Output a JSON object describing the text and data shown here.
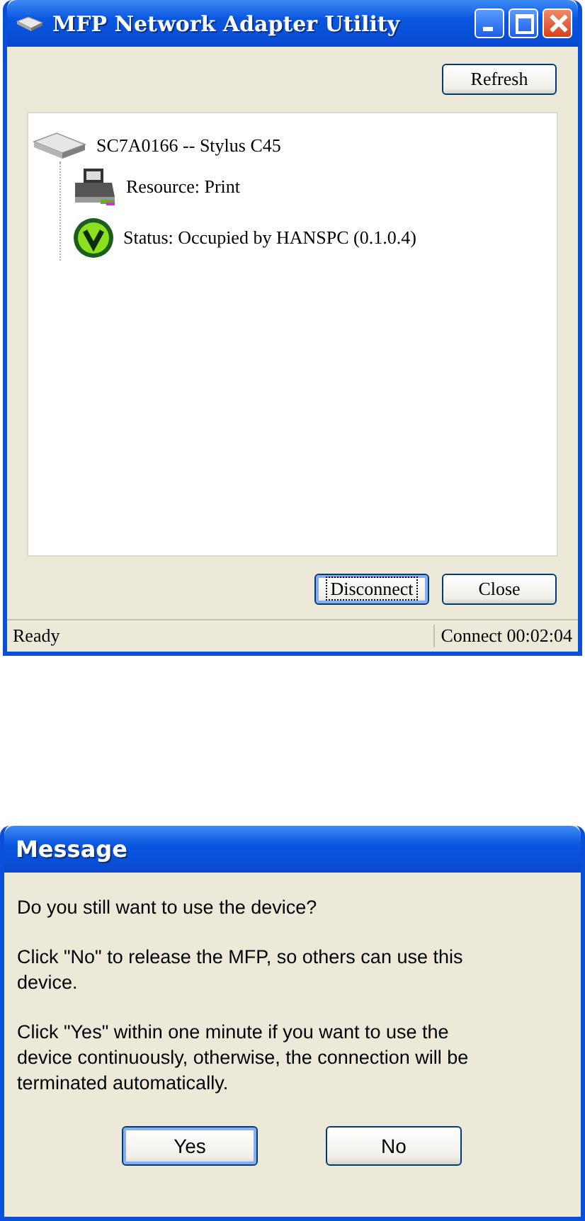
{
  "main_window": {
    "title": "MFP Network Adapter Utility",
    "title_buttons": [
      {
        "kind": "minimize"
      },
      {
        "kind": "maximize"
      },
      {
        "kind": "close"
      }
    ],
    "top_buttons": [
      {
        "label": "Refresh",
        "focused": false
      }
    ],
    "tree": [
      {
        "kind": "adapter",
        "label": "SC7A0166 -- Stylus C45",
        "children": [
          {
            "kind": "printer",
            "label": "Resource: Print"
          },
          {
            "kind": "status-ok",
            "label": "Status: Occupied by HANSPC (0.1.0.4)"
          }
        ]
      }
    ],
    "bottom_buttons": [
      {
        "label": "Disconnect",
        "focused": true
      },
      {
        "label": "Close",
        "focused": false
      }
    ],
    "status_bar": [
      "Ready",
      "Connect 00:02:04"
    ]
  },
  "message_dialog": {
    "title": "Message",
    "paragraphs": [
      "Do you still want to use the device?",
      "Click \"No\" to release the MFP, so others can use this device.",
      "Click \"Yes\" within one minute if you want to use the device continuously,  otherwise, the connection will be terminated automatically."
    ],
    "buttons": [
      {
        "label": "Yes",
        "focused": true
      },
      {
        "label": "No",
        "focused": false
      }
    ]
  }
}
